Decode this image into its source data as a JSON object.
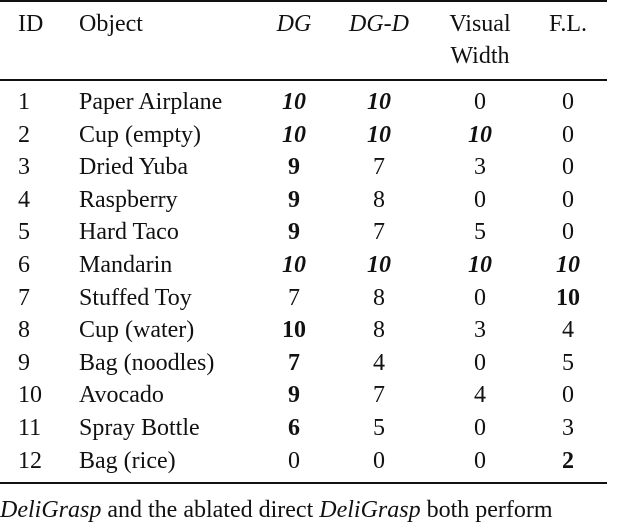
{
  "table": {
    "headers": {
      "id": "ID",
      "object": "Object",
      "dg": "DG",
      "dgd": "DG-D",
      "visual_width_line1": "Visual",
      "visual_width_line2": "Width",
      "fl": "F.L."
    },
    "rows": [
      {
        "id": "1",
        "object": "Paper Airplane",
        "dg": {
          "v": "10",
          "style": "bi"
        },
        "dgd": {
          "v": "10",
          "style": "bi"
        },
        "vw": {
          "v": "0",
          "style": ""
        },
        "fl": {
          "v": "0",
          "style": ""
        }
      },
      {
        "id": "2",
        "object": "Cup (empty)",
        "dg": {
          "v": "10",
          "style": "bi"
        },
        "dgd": {
          "v": "10",
          "style": "bi"
        },
        "vw": {
          "v": "10",
          "style": "bi"
        },
        "fl": {
          "v": "0",
          "style": ""
        }
      },
      {
        "id": "3",
        "object": "Dried Yuba",
        "dg": {
          "v": "9",
          "style": "b"
        },
        "dgd": {
          "v": "7",
          "style": ""
        },
        "vw": {
          "v": "3",
          "style": ""
        },
        "fl": {
          "v": "0",
          "style": ""
        }
      },
      {
        "id": "4",
        "object": "Raspberry",
        "dg": {
          "v": "9",
          "style": "b"
        },
        "dgd": {
          "v": "8",
          "style": ""
        },
        "vw": {
          "v": "0",
          "style": ""
        },
        "fl": {
          "v": "0",
          "style": ""
        }
      },
      {
        "id": "5",
        "object": "Hard Taco",
        "dg": {
          "v": "9",
          "style": "b"
        },
        "dgd": {
          "v": "7",
          "style": ""
        },
        "vw": {
          "v": "5",
          "style": ""
        },
        "fl": {
          "v": "0",
          "style": ""
        }
      },
      {
        "id": "6",
        "object": "Mandarin",
        "dg": {
          "v": "10",
          "style": "bi"
        },
        "dgd": {
          "v": "10",
          "style": "bi"
        },
        "vw": {
          "v": "10",
          "style": "bi"
        },
        "fl": {
          "v": "10",
          "style": "bi"
        }
      },
      {
        "id": "7",
        "object": "Stuffed Toy",
        "dg": {
          "v": "7",
          "style": ""
        },
        "dgd": {
          "v": "8",
          "style": ""
        },
        "vw": {
          "v": "0",
          "style": ""
        },
        "fl": {
          "v": "10",
          "style": "b"
        }
      },
      {
        "id": "8",
        "object": "Cup (water)",
        "dg": {
          "v": "10",
          "style": "b"
        },
        "dgd": {
          "v": "8",
          "style": ""
        },
        "vw": {
          "v": "3",
          "style": ""
        },
        "fl": {
          "v": "4",
          "style": ""
        }
      },
      {
        "id": "9",
        "object": "Bag (noodles)",
        "dg": {
          "v": "7",
          "style": "b"
        },
        "dgd": {
          "v": "4",
          "style": ""
        },
        "vw": {
          "v": "0",
          "style": ""
        },
        "fl": {
          "v": "5",
          "style": ""
        }
      },
      {
        "id": "10",
        "object": "Avocado",
        "dg": {
          "v": "9",
          "style": "b"
        },
        "dgd": {
          "v": "7",
          "style": ""
        },
        "vw": {
          "v": "4",
          "style": ""
        },
        "fl": {
          "v": "0",
          "style": ""
        }
      },
      {
        "id": "11",
        "object": "Spray Bottle",
        "dg": {
          "v": "6",
          "style": "b"
        },
        "dgd": {
          "v": "5",
          "style": ""
        },
        "vw": {
          "v": "0",
          "style": ""
        },
        "fl": {
          "v": "3",
          "style": ""
        }
      },
      {
        "id": "12",
        "object": "Bag (rice)",
        "dg": {
          "v": "0",
          "style": ""
        },
        "dgd": {
          "v": "0",
          "style": ""
        },
        "vw": {
          "v": "0",
          "style": ""
        },
        "fl": {
          "v": "2",
          "style": "b"
        }
      }
    ]
  },
  "caption": {
    "parts": [
      {
        "text": "DeliGrasp",
        "italic": true
      },
      {
        "text": " and the ablated direct ",
        "italic": false
      },
      {
        "text": "DeliGrasp",
        "italic": true
      },
      {
        "text": " both perform",
        "italic": false
      }
    ]
  }
}
